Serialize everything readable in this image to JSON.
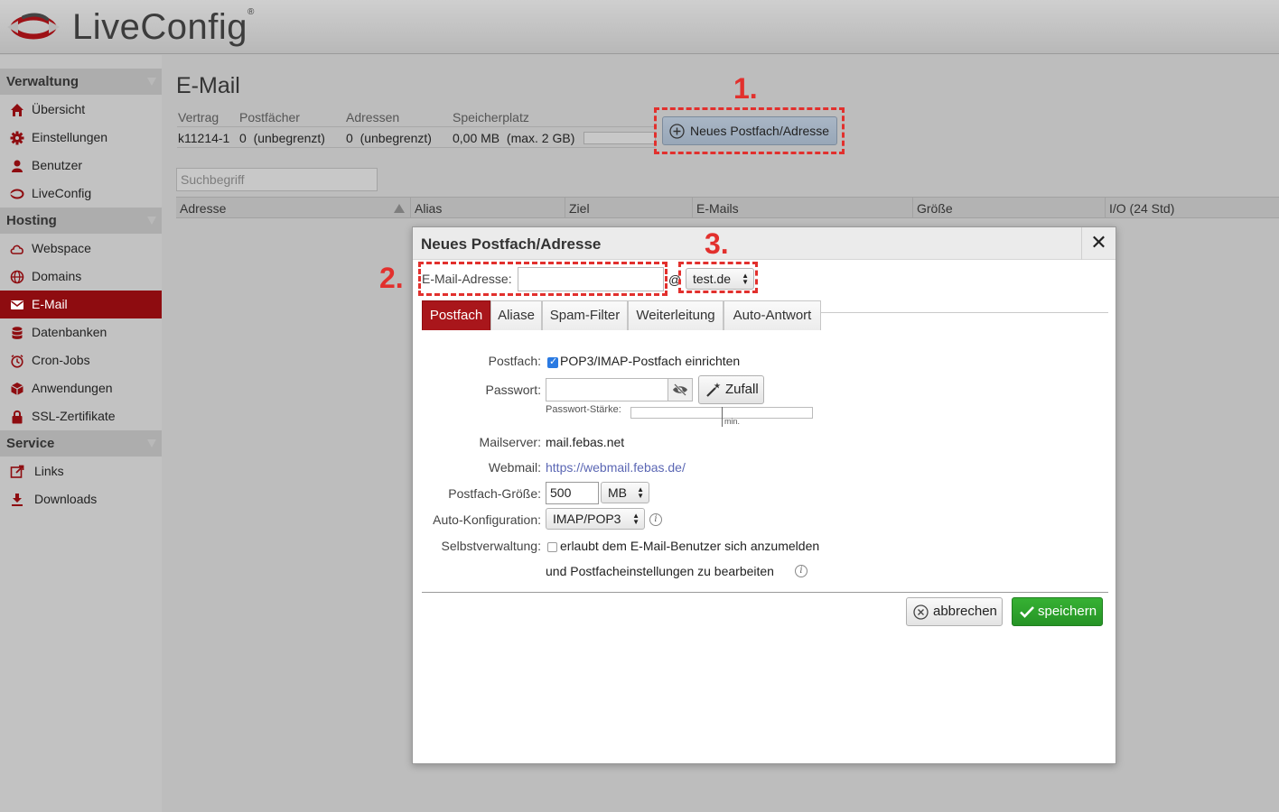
{
  "app": {
    "logo_text": "LiveConfig",
    "logo_reg": "®"
  },
  "colors": {
    "brand": "#8e0c10",
    "accent_red": "#e2302d",
    "save_green": "#2e9d2b"
  },
  "sidebar": {
    "sections": [
      {
        "title": "Verwaltung",
        "items": [
          {
            "label": "Übersicht",
            "icon": "home-icon"
          },
          {
            "label": "Einstellungen",
            "icon": "gear-icon"
          },
          {
            "label": "Benutzer",
            "icon": "user-icon"
          },
          {
            "label": "LiveConfig",
            "icon": "liveconfig-logo-icon"
          }
        ]
      },
      {
        "title": "Hosting",
        "items": [
          {
            "label": "Webspace",
            "icon": "cloud-icon"
          },
          {
            "label": "Domains",
            "icon": "globe-icon"
          },
          {
            "label": "E-Mail",
            "icon": "envelope-icon",
            "active": true
          },
          {
            "label": "Datenbanken",
            "icon": "database-icon"
          },
          {
            "label": "Cron-Jobs",
            "icon": "clock-icon"
          },
          {
            "label": "Anwendungen",
            "icon": "cube-icon"
          },
          {
            "label": "SSL-Zertifikate",
            "icon": "lock-icon"
          }
        ]
      },
      {
        "title": "Service",
        "items": [
          {
            "label": "Links",
            "icon": "external-link-icon"
          },
          {
            "label": "Downloads",
            "icon": "download-icon"
          }
        ]
      }
    ]
  },
  "page": {
    "title": "E-Mail",
    "stats": {
      "headers": [
        "Vertrag",
        "Postfächer",
        "Adressen",
        "Speicherplatz"
      ],
      "contract": "k11214-1",
      "mailboxes": "0  (unbegrenzt)",
      "addresses": "0  (unbegrenzt)",
      "storage": "0,00 MB  (max. 2 GB)",
      "storage_used_fraction": 0
    },
    "new_button": "Neues Postfach/Adresse",
    "search_placeholder": "Suchbegriff",
    "table_headers": [
      "Adresse",
      "Alias",
      "Ziel",
      "E-Mails",
      "Größe",
      "I/O (24 Std)"
    ]
  },
  "annotations": [
    "1.",
    "2.",
    "3."
  ],
  "dialog": {
    "title": "Neues Postfach/Adresse",
    "email_label": "E-Mail-Adresse:",
    "email_value": "",
    "at": "@",
    "domain": "test.de",
    "tabs": [
      "Postfach",
      "Aliase",
      "Spam-Filter",
      "Weiterleitung",
      "Auto-Antwort"
    ],
    "active_tab": "Postfach",
    "mailbox_label": "Postfach:",
    "mailbox_checkbox": "POP3/IMAP-Postfach einrichten",
    "mailbox_checked": true,
    "password_label": "Passwort:",
    "password_value": "",
    "random_button": "Zufall",
    "strength_label": "Passwort-Stärke:",
    "strength_min": "min.",
    "mailserver_label": "Mailserver:",
    "mailserver": "mail.febas.net",
    "webmail_label": "Webmail:",
    "webmail": "https://webmail.febas.de/",
    "size_label": "Postfach-Größe:",
    "size_value": "500",
    "size_unit": "MB",
    "autoconfig_label": "Auto-Konfiguration:",
    "autoconfig_value": "IMAP/POP3",
    "selfadmin_label": "Selbstverwaltung:",
    "selfadmin_line1": "erlaubt dem E-Mail-Benutzer sich anzumelden",
    "selfadmin_line2": "und Postfacheinstellungen zu bearbeiten",
    "selfadmin_checked": false,
    "cancel_button": "abbrechen",
    "save_button": "speichern",
    "close_symbol": "✕"
  }
}
